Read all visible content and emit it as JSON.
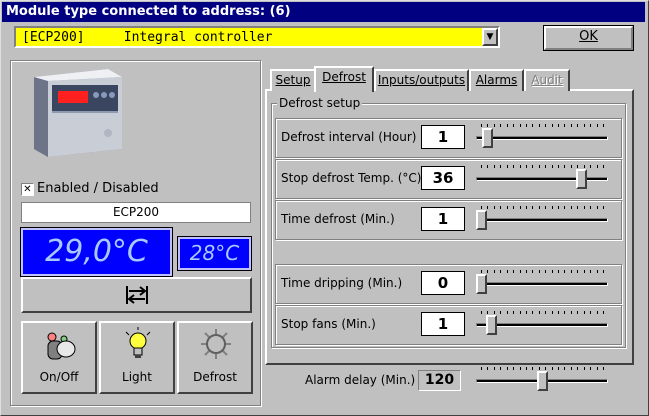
{
  "window": {
    "title": "Module type connected to address: (6)"
  },
  "module_select": {
    "value": "[ECP200]     Integral controller"
  },
  "ok_button": {
    "label": "OK"
  },
  "device": {
    "enabled_label": "Enabled / Disabled",
    "enabled_checked": true,
    "name": "ECP200",
    "main_display": "29,0°C",
    "secondary_display": "28°C"
  },
  "controls": {
    "onoff_label": "On/Off",
    "light_label": "Light",
    "defrost_label": "Defrost"
  },
  "tabs": [
    {
      "label": "Setup",
      "active": false,
      "disabled": false
    },
    {
      "label": "Defrost",
      "active": true,
      "disabled": false
    },
    {
      "label": "Inputs/outputs",
      "active": false,
      "disabled": false
    },
    {
      "label": "Alarms",
      "active": false,
      "disabled": false
    },
    {
      "label": "Audit",
      "active": false,
      "disabled": true
    }
  ],
  "defrost": {
    "group_title": "Defrost setup",
    "rows": [
      {
        "label": "Defrost interval (Hour)",
        "value": "1",
        "slider_pct": 0.05
      },
      {
        "label": "Stop defrost Temp. (°C)",
        "value": "36",
        "slider_pct": 0.83
      },
      {
        "label": "Time defrost (Min.)",
        "value": "1",
        "slider_pct": 0.0
      },
      {
        "label": "Time dripping (Min.)",
        "value": "0",
        "slider_pct": 0.0
      },
      {
        "label": "Stop fans (Min.)",
        "value": "1",
        "slider_pct": 0.08
      }
    ]
  },
  "alarm_delay": {
    "label": "Alarm delay (Min.)",
    "value": "120",
    "slider_pct": 0.5
  }
}
